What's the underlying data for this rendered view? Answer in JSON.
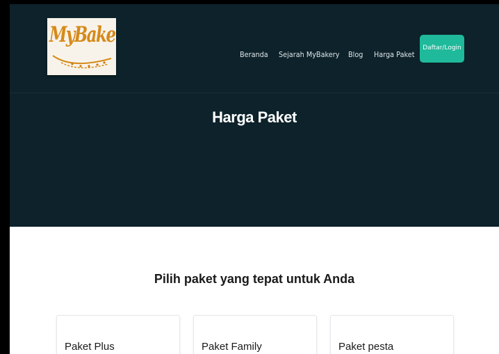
{
  "brand": {
    "logo_text": "MyBakery",
    "colors": {
      "hero_background": "#0d222a",
      "accent": "#1fb99b",
      "logo_text": "#d68a1a"
    }
  },
  "nav": {
    "items": [
      {
        "label": "Beranda"
      },
      {
        "label": "Sejarah MyBakery"
      },
      {
        "label": "Blog"
      },
      {
        "label": "Harga Paket"
      }
    ],
    "cta_label": "Daftar/Login"
  },
  "hero": {
    "title": "Harga Paket"
  },
  "packages": {
    "heading": "Pilih paket yang tepat untuk Anda",
    "cards": [
      {
        "title": "Paket Plus"
      },
      {
        "title": "Paket Family"
      },
      {
        "title": "Paket pesta"
      }
    ]
  }
}
